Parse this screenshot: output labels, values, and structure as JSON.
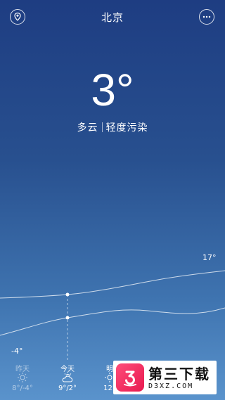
{
  "header": {
    "city": "北京"
  },
  "current": {
    "temperature": "3°",
    "condition": "多云",
    "air_quality": "轻度污染"
  },
  "chart": {
    "high_label": "17°",
    "low_label": "-4°"
  },
  "days": [
    {
      "name": "昨天",
      "icon": "sun-icon",
      "range": "8°/-4°"
    },
    {
      "name": "今天",
      "icon": "partly-cloudy-icon",
      "range": "9°/2°"
    },
    {
      "name": "明",
      "icon": "sun-icon",
      "range": "12°"
    }
  ],
  "watermark": {
    "title": "第三下载",
    "subtitle": "D3XZ.COM"
  },
  "colors": {
    "background_top": "#1e3d82",
    "background_bottom": "#5a93cc",
    "watermark_accent": "#e8194f"
  }
}
